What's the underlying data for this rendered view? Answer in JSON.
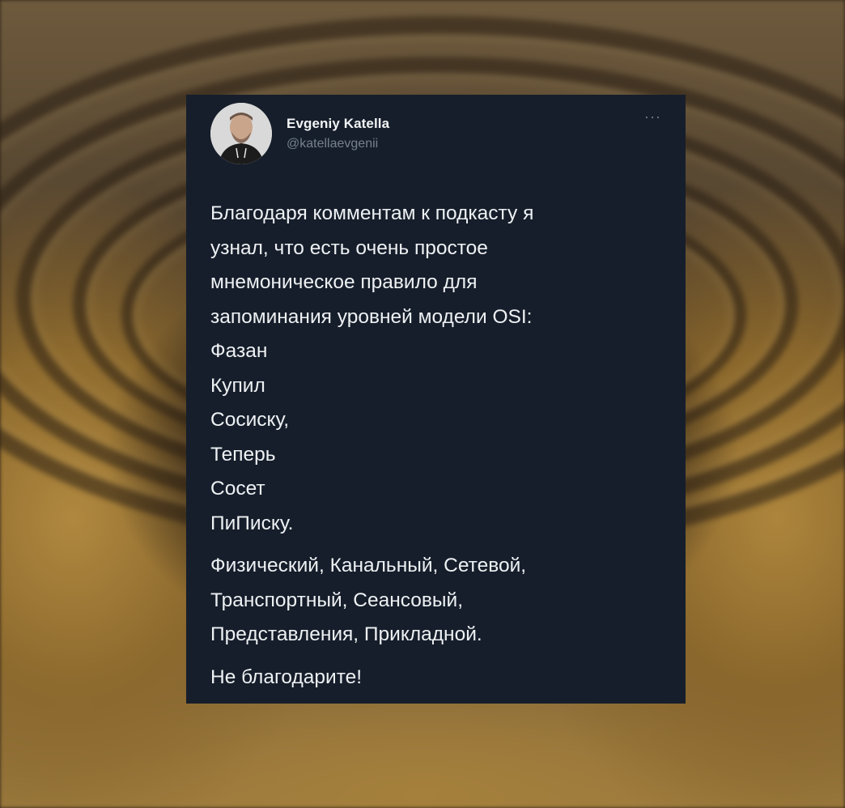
{
  "tweet": {
    "author_name": "Evgeniy Katella",
    "author_handle": "@katellaevgenii",
    "more_icon": "more-dots-icon",
    "intro_lines": [
      "Благодаря комментам к подкасту я",
      "узнал, что есть очень простое",
      "мнемоническое правило для",
      "запоминания уровней модели OSI:"
    ],
    "mnemonic_lines": [
      "Фазан",
      "Купил",
      "Сосиску,",
      "Теперь",
      "Сосет",
      "ПиПиску."
    ],
    "layers_lines": [
      "Физический, Канальный, Сетевой,",
      "Транспортный, Сеансовый,",
      "Представления, Прикладной."
    ],
    "closing": "Не благодарите!"
  },
  "colors": {
    "card_background": "#161e2b",
    "text_primary": "#eef1f3",
    "text_secondary": "#76818c"
  }
}
